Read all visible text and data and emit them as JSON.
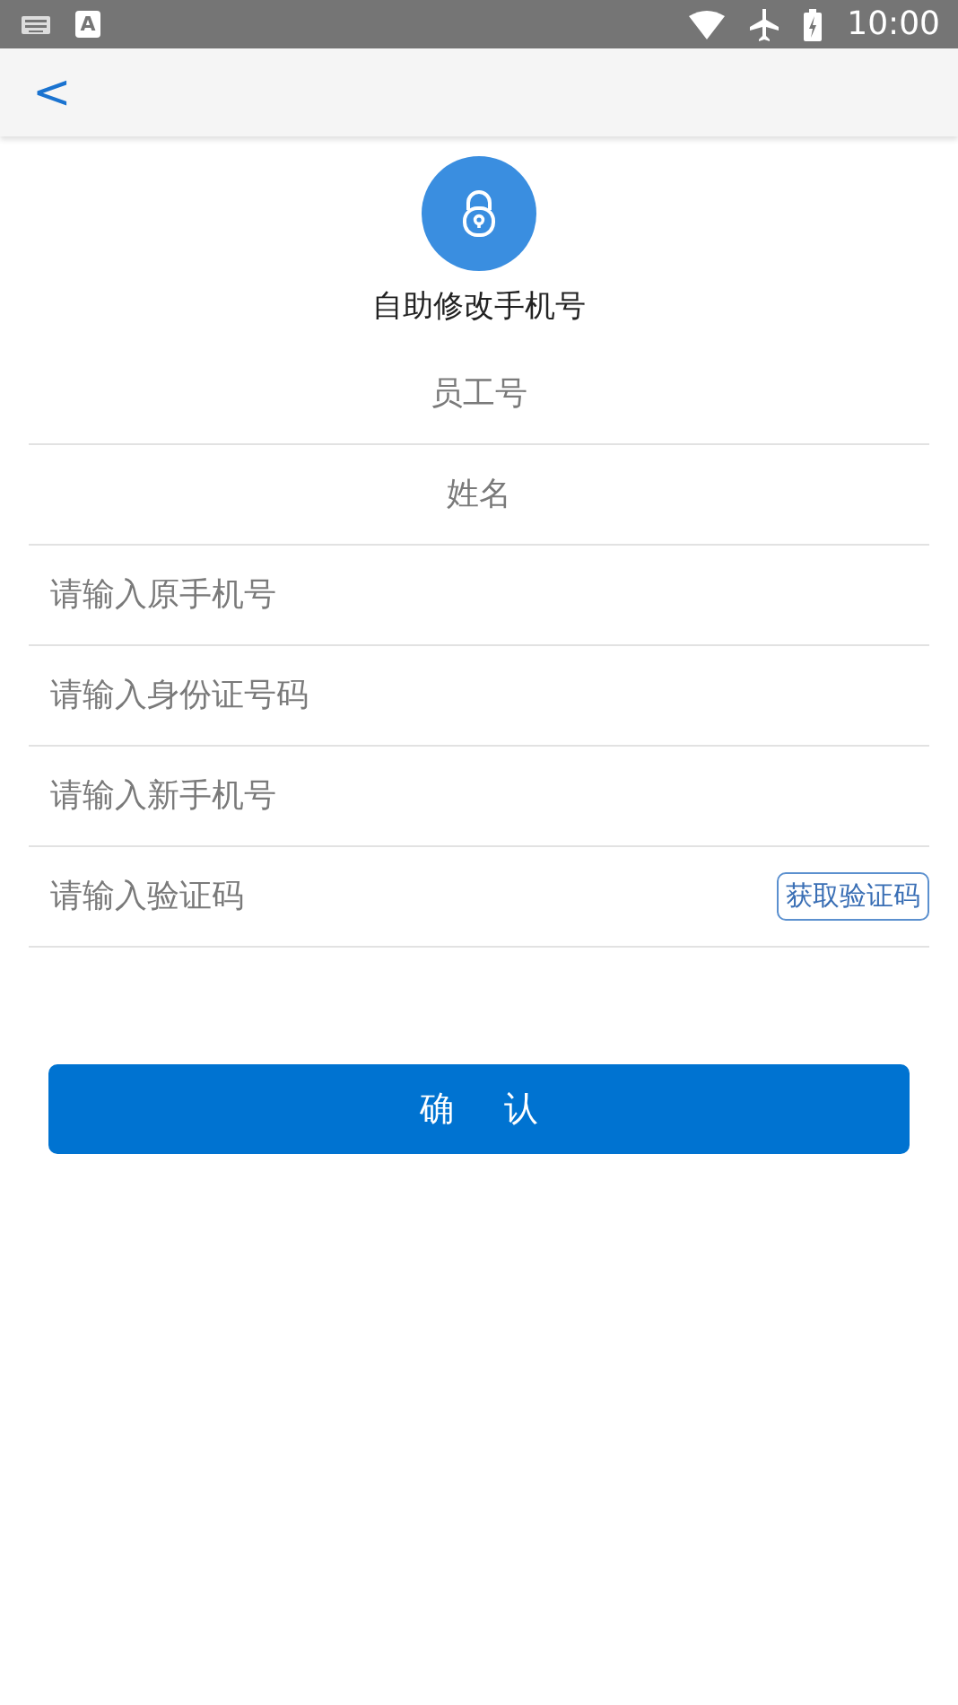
{
  "status_bar": {
    "badge": "A",
    "time": "10:00"
  },
  "header": {
    "back": "<"
  },
  "title": "自助修改手机号",
  "fields": [
    {
      "kind": "centered",
      "placeholder": "员工号"
    },
    {
      "kind": "centered",
      "placeholder": "姓名"
    },
    {
      "kind": "plain",
      "placeholder": "请输入原手机号"
    },
    {
      "kind": "plain",
      "placeholder": "请输入身份证号码"
    },
    {
      "kind": "plain",
      "placeholder": "请输入新手机号"
    },
    {
      "kind": "code",
      "placeholder": "请输入验证码",
      "action": "获取验证码"
    }
  ],
  "confirm": "确 认"
}
